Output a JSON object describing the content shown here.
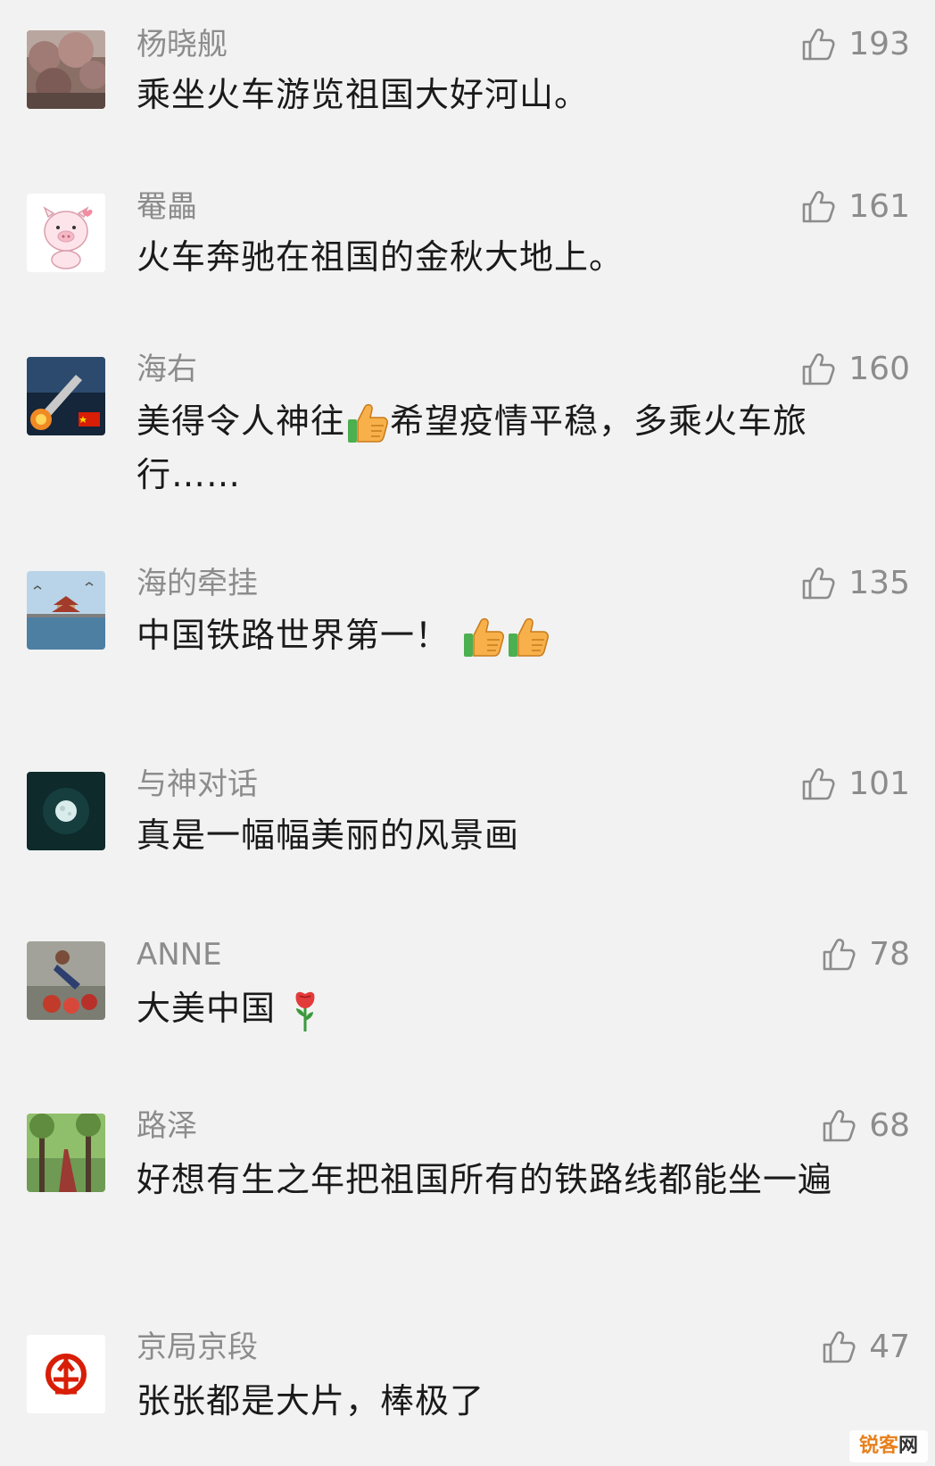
{
  "comments": [
    {
      "name": "杨晓舰",
      "text": "乘坐火车游览祖国大好河山。",
      "likes": "193",
      "avatar": "cherry-blossom-photo"
    },
    {
      "name": "罨畾",
      "text": "火车奔驰在祖国的金秋大地上。",
      "likes": "161",
      "avatar": "cartoon-pig"
    },
    {
      "name": "海右",
      "text_a": "美得令人神往",
      "text_b": "希望疫情平稳，多乘火车旅行……",
      "likes": "160",
      "avatar": "rocket-launch-photo"
    },
    {
      "name": "海的牵挂",
      "text": "中国铁路世界第一！",
      "likes": "135",
      "avatar": "pavilion-sea-photo"
    },
    {
      "name": "与神对话",
      "text": "真是一幅幅美丽的风景画",
      "likes": "101",
      "avatar": "moon-photo"
    },
    {
      "name": "ANNE",
      "text": "大美中国",
      "likes": "78",
      "avatar": "person-photo"
    },
    {
      "name": "路泽",
      "text": "好想有生之年把祖国所有的铁路线都能坐一遍",
      "likes": "68",
      "avatar": "tree-road-photo"
    },
    {
      "name": "京局京段",
      "text": "张张都是大片，棒极了",
      "likes": "47",
      "avatar": "railway-logo"
    }
  ],
  "icons": {
    "like": "thumbs-up-outline-icon",
    "emoji_thumb": "thumbs-up-emoji",
    "emoji_rose": "rose-emoji"
  },
  "watermark": {
    "main": "锐客",
    "tail": "网"
  },
  "colors": {
    "background": "#f2f2f2",
    "name": "#8c8c8c",
    "text": "#1a1a1a",
    "railway_red": "#d81e06"
  }
}
